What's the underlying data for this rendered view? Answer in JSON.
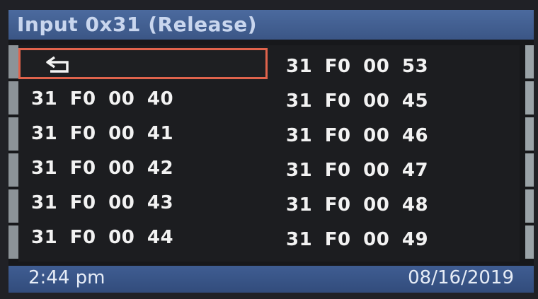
{
  "header": {
    "title": "Input 0x31 (Release)"
  },
  "back_button": {
    "icon": "back-arrow-icon"
  },
  "items": [
    "31 F0 00 40",
    "31 F0 00 41",
    "31 F0 00 42",
    "31 F0 00 43",
    "31 F0 00 44",
    "31 F0 00 53",
    "31 F0 00 45",
    "31 F0 00 46",
    "31 F0 00 47",
    "31 F0 00 48",
    "31 F0 00 49"
  ],
  "status": {
    "time": "2:44 pm",
    "date": "08/16/2019"
  },
  "colors": {
    "highlight": "#e0634c",
    "titlebar": "#3b5686",
    "statusbar": "#324c7c"
  }
}
